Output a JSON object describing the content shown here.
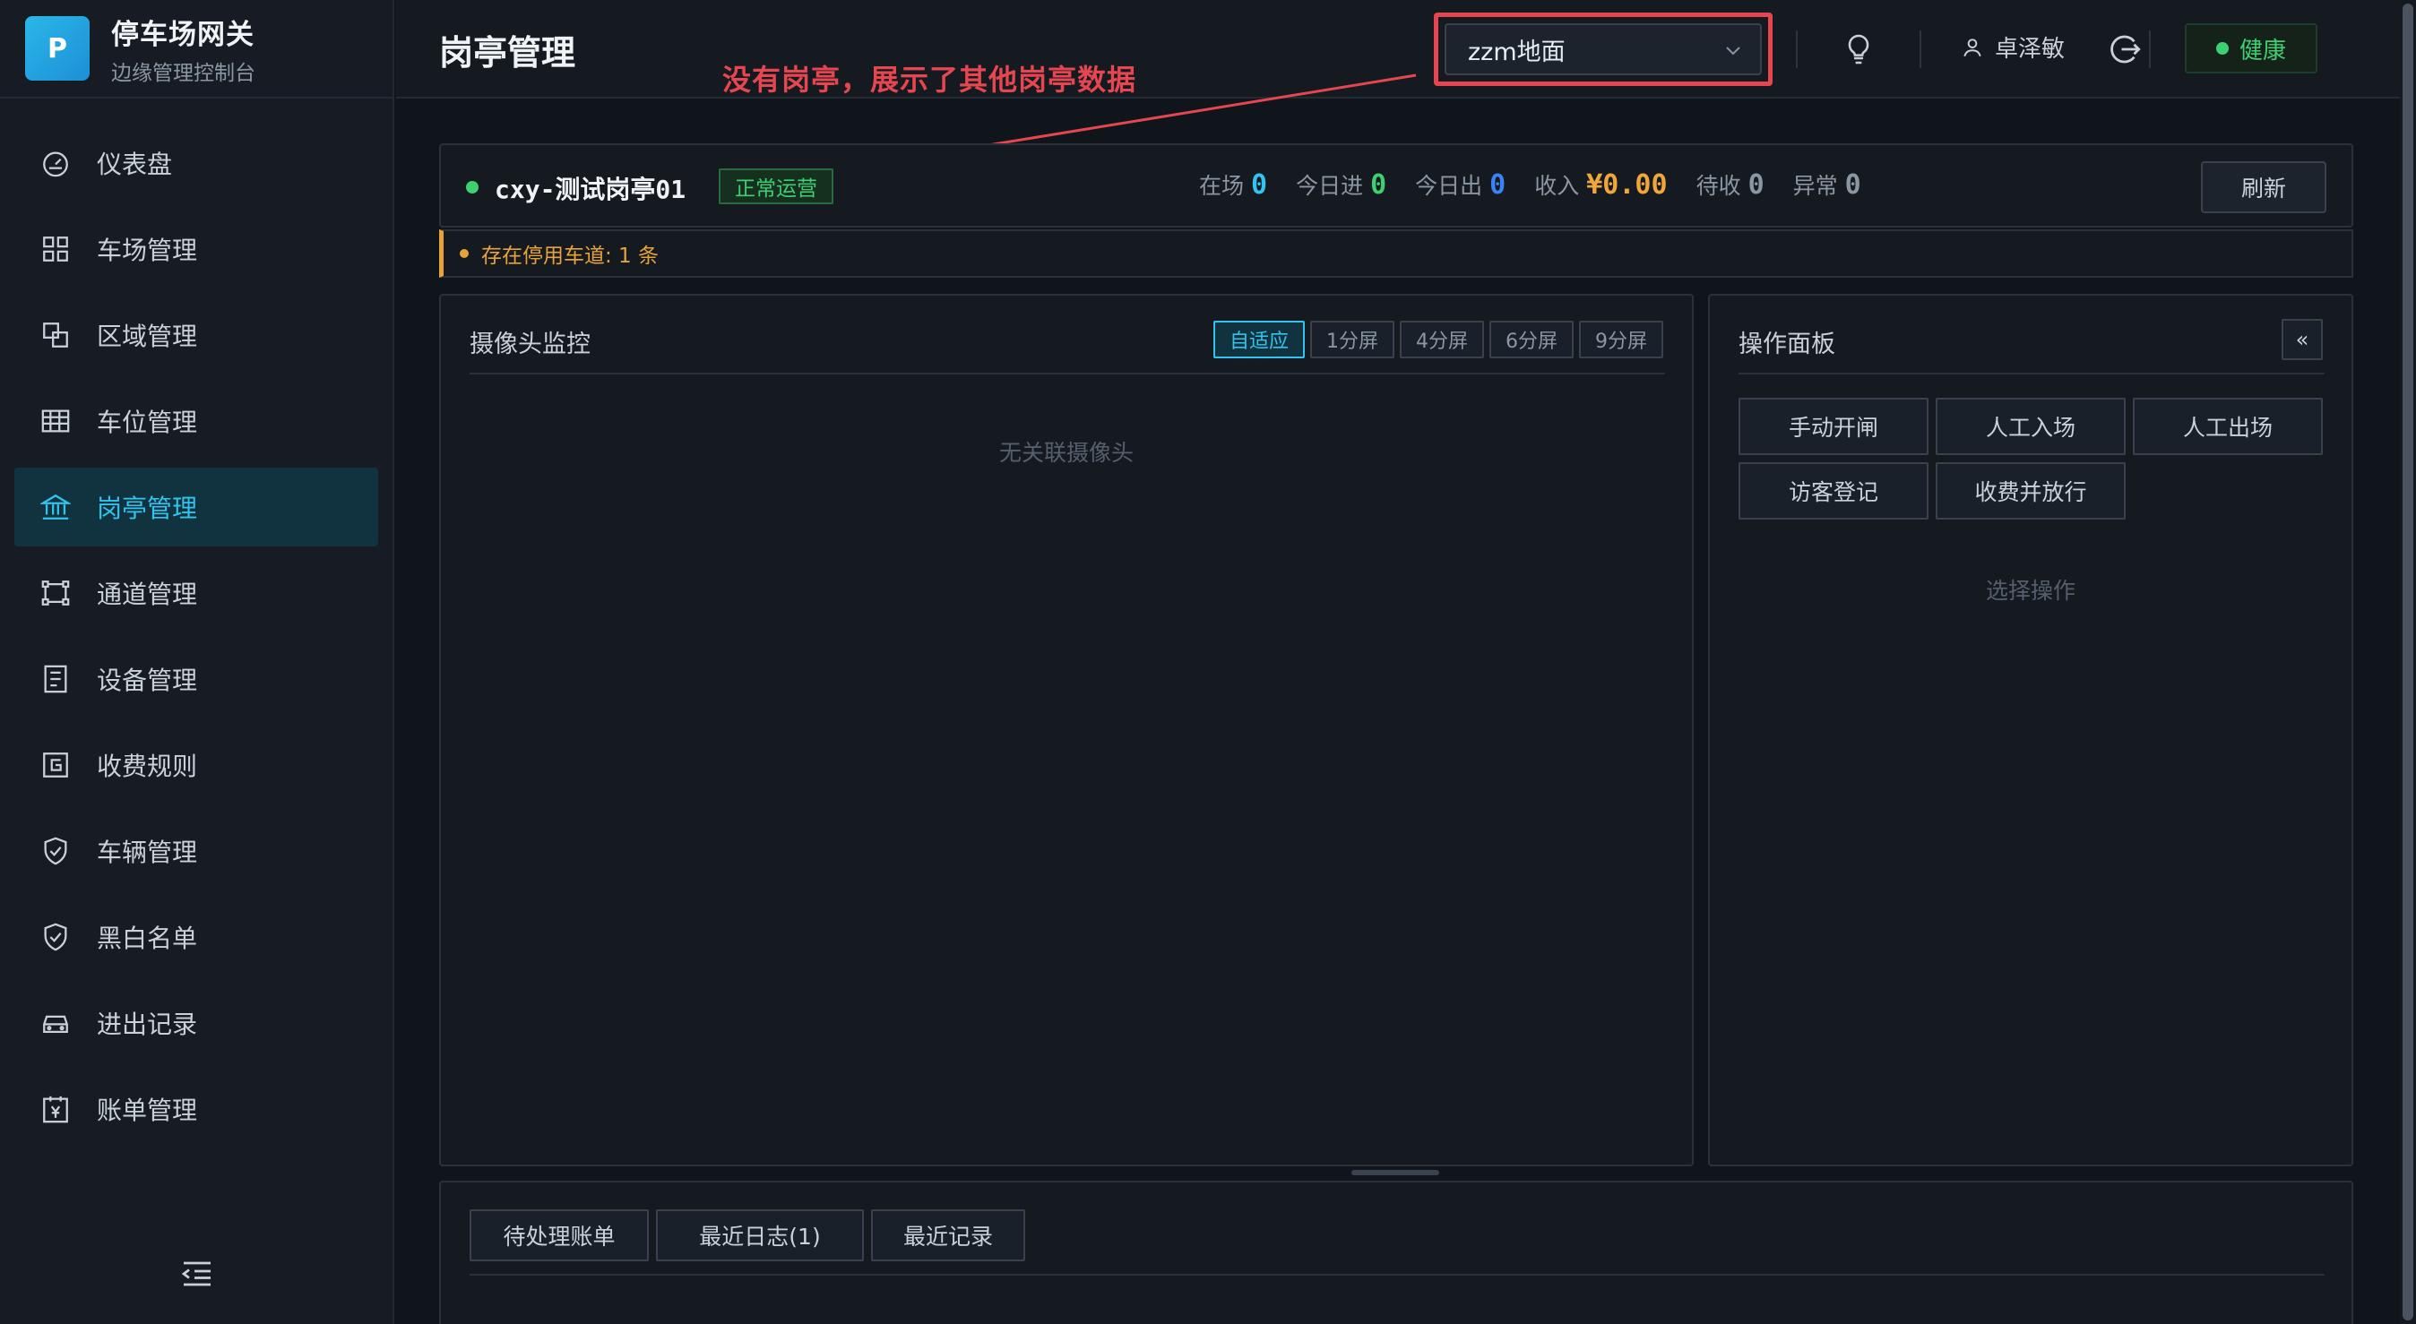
{
  "brand": {
    "logo": "P",
    "title": "停车场网关",
    "subtitle": "边缘管理控制台"
  },
  "sidebar": {
    "items": [
      {
        "label": "仪表盘",
        "icon": "dashboard-icon"
      },
      {
        "label": "车场管理",
        "icon": "grid-icon"
      },
      {
        "label": "区域管理",
        "icon": "layers-icon"
      },
      {
        "label": "车位管理",
        "icon": "table-icon"
      },
      {
        "label": "岗亭管理",
        "icon": "bank-icon",
        "active": true
      },
      {
        "label": "通道管理",
        "icon": "channel-icon"
      },
      {
        "label": "设备管理",
        "icon": "device-icon"
      },
      {
        "label": "收费规则",
        "icon": "billing-rule-icon"
      },
      {
        "label": "车辆管理",
        "icon": "shield-icon"
      },
      {
        "label": "黑白名单",
        "icon": "shield-icon"
      },
      {
        "label": "进出记录",
        "icon": "car-icon"
      },
      {
        "label": "账单管理",
        "icon": "bill-icon"
      }
    ]
  },
  "header": {
    "title": "岗亭管理",
    "select_value": "zzm地面",
    "user": "卓泽敏",
    "health": "健康"
  },
  "annotation": {
    "text": "没有岗亭，展示了其他岗亭数据",
    "color": "#e5464f"
  },
  "booth": {
    "name": "cxy-测试岗亭01",
    "status": "正常运营",
    "stats": [
      {
        "label": "在场",
        "value": "0",
        "color": "#32c4ee"
      },
      {
        "label": "今日进",
        "value": "0",
        "color": "#3ecf72"
      },
      {
        "label": "今日出",
        "value": "0",
        "color": "#3b82f6"
      },
      {
        "label": "收入",
        "value": "¥0.00",
        "color": "#f0a73a"
      },
      {
        "label": "待收",
        "value": "0",
        "color": "#8b96a3"
      },
      {
        "label": "异常",
        "value": "0",
        "color": "#8b96a3"
      }
    ],
    "refresh_label": "刷新",
    "warning": "存在停用车道: 1 条"
  },
  "camera_panel": {
    "title": "摄像头监控",
    "layouts": [
      "自适应",
      "1分屏",
      "4分屏",
      "6分屏",
      "9分屏"
    ],
    "active_layout": "自适应",
    "empty": "无关联摄像头"
  },
  "op_panel": {
    "title": "操作面板",
    "collapse": "«",
    "buttons": [
      "手动开闸",
      "人工入场",
      "人工出场",
      "访客登记",
      "收费并放行"
    ],
    "empty": "选择操作"
  },
  "bottom_tabs": [
    "待处理账单",
    "最近日志(1)",
    "最近记录"
  ]
}
